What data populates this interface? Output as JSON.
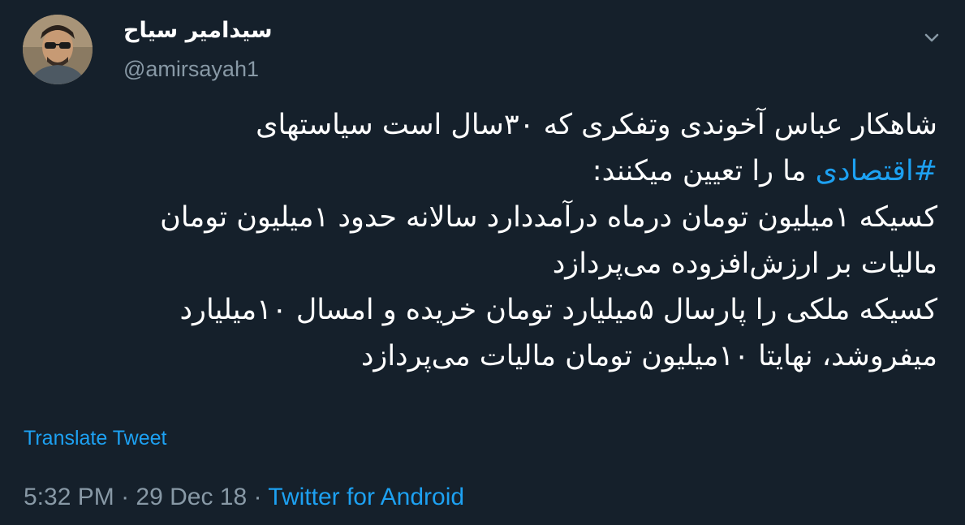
{
  "author": {
    "display_name": "سیدامیر سیاح",
    "handle": "@amirsayah1"
  },
  "tweet": {
    "line1": "شاهکار عباس آخوندی وتفکری که ۳۰سال است سیاستهای",
    "hashtag": "#اقتصادی",
    "line2_rest": " ما را تعیین میکنند:",
    "line3": "کسیکه ۱میلیون تومان درماه درآمددارد سالانه حدود ۱میلیون تومان",
    "line4": "مالیات بر ارزش‌افزوده می‌پردازد",
    "line5": "کسیکه ملکی را پارسال ۵میلیارد تومان خریده و امسال ۱۰میلیارد",
    "line6": "میفروشد، نهایتا ۱۰میلیون تومان مالیات می‌پردازد"
  },
  "actions": {
    "translate_label": "Translate Tweet"
  },
  "meta": {
    "time": "5:32 PM",
    "separator": " · ",
    "date": "29 Dec 18",
    "source": "Twitter for Android"
  },
  "colors": {
    "background": "#15202b",
    "text": "#ffffff",
    "muted": "#8899a6",
    "accent": "#1da1f2"
  },
  "icons": {
    "menu_caret": "chevron-down-icon"
  }
}
